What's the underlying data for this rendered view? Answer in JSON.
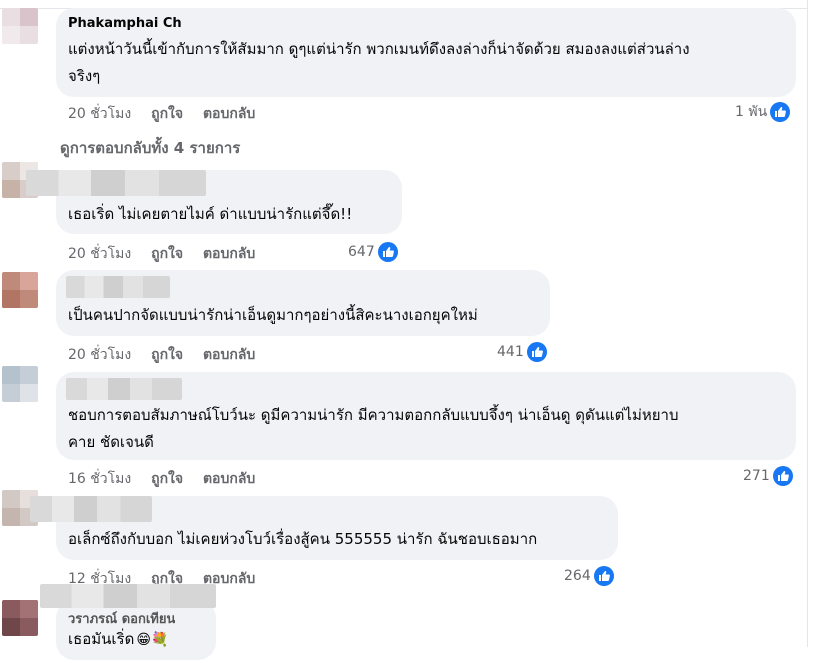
{
  "colors": {
    "bubble_bg": "#f0f2f5",
    "meta_text": "#65676b",
    "like_blue": "#1877f2"
  },
  "comments": [
    {
      "author": "Phakamphai Ch",
      "text_lines": [
        "แต่งหน้าวันนี้เข้ากับการให้สัมมาก ดูๆแต่น่ารัก พวกเมนท์ดึงลงล่างก็น่าจัดด้วย สมองลงแต่ส่วนล่าง",
        "จริงๆ"
      ],
      "time": "20 ชั่วโมง",
      "like_label": "ถูกใจ",
      "reply_label": "ตอบกลับ",
      "reactions": "1 พัน"
    },
    {
      "author": "",
      "text_lines": [
        "เธอเริ่ด ไม่เคยตายไมค์ ด่าแบบน่ารักแต่จึ๊ด!!"
      ],
      "time": "20 ชั่วโมง",
      "like_label": "ถูกใจ",
      "reply_label": "ตอบกลับ",
      "reactions": "647"
    },
    {
      "author": "",
      "text_lines": [
        "เป็นคนปากจัดแบบน่ารักน่าเอ็นดูมากๆอย่างนี้สิคะนางเอกยุคใหม่"
      ],
      "time": "20 ชั่วโมง",
      "like_label": "ถูกใจ",
      "reply_label": "ตอบกลับ",
      "reactions": "441"
    },
    {
      "author": "",
      "text_lines": [
        "ชอบการตอบสัมภาษณ์โบว์นะ ดูมีความน่ารัก มีความตอกกลับแบบจึ้งๆ น่าเอ็นดู ดุดันแต่ไม่หยาบ",
        "คาย ชัดเจนดี"
      ],
      "time": "16 ชั่วโมง",
      "like_label": "ถูกใจ",
      "reply_label": "ตอบกลับ",
      "reactions": "271"
    },
    {
      "author": "",
      "text_lines": [
        "อเล็กซ์ถึงกับบอก ไม่เคยห่วงโบว์เรื่องสู้คน 555555 น่ารัก ฉันชอบเธอมาก"
      ],
      "time": "12 ชั่วโมง",
      "like_label": "ถูกใจ",
      "reply_label": "ตอบกลับ",
      "reactions": "264"
    },
    {
      "author": "วราภรณ์ ดอกเทียน",
      "text_lines": [
        "เธอมันเริ่ด"
      ],
      "emoji": "😁💐"
    }
  ],
  "view_replies": "ดูการตอบกลับทั้ง 4 รายการ"
}
